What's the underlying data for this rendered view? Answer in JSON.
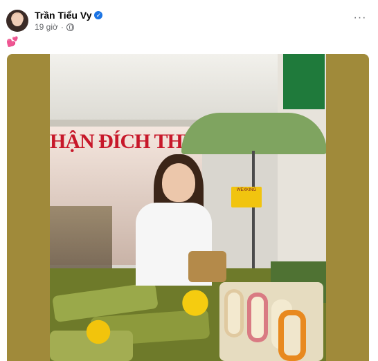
{
  "post": {
    "author_name": "Trần Tiểu Vy",
    "time": "19 giờ",
    "dot": "·",
    "more_glyph": "···",
    "caption_emoji": "💕",
    "verified_glyph": "✓"
  },
  "photo": {
    "sign_text": "HẬN ĐÍCH THỰC VỀ",
    "store_sign": "WEXKING",
    "frame_color": "#a08a3a"
  },
  "icons": [
    "avatar",
    "verified-badge-icon",
    "globe-icon",
    "more-options-icon",
    "heart-emoji-icon"
  ]
}
